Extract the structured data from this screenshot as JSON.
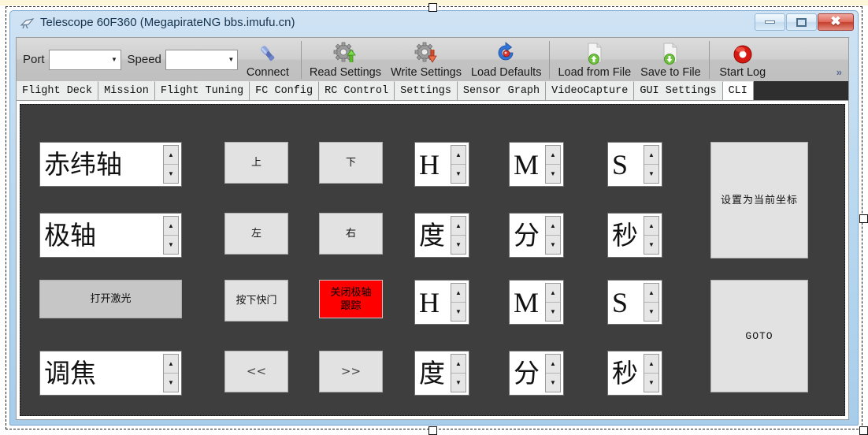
{
  "window": {
    "title": "Telescope 60F360 (MegapirateNG bbs.imufu.cn)",
    "icon": "telescope-icon",
    "controls": {
      "minimize": "minimize-icon",
      "maximize": "maximize-icon",
      "close": "✖"
    }
  },
  "toolbar": {
    "port_label": "Port",
    "port_value": "",
    "speed_label": "Speed",
    "speed_value": "",
    "overflow": "»",
    "buttons": [
      {
        "label": "Connect",
        "icon": "plug-icon"
      },
      {
        "label": "Read Settings",
        "icon": "gear-up-icon"
      },
      {
        "label": "Write Settings",
        "icon": "gear-down-icon"
      },
      {
        "label": "Load Defaults",
        "icon": "refresh-icon"
      },
      {
        "label": "Load from File",
        "icon": "file-up-icon"
      },
      {
        "label": "Save to File",
        "icon": "file-down-icon"
      },
      {
        "label": "Start Log",
        "icon": "record-icon"
      }
    ]
  },
  "tabs": [
    {
      "label": "Flight Deck",
      "active": false
    },
    {
      "label": "Mission",
      "active": false
    },
    {
      "label": "Flight Tuning",
      "active": false
    },
    {
      "label": "FC Config",
      "active": false
    },
    {
      "label": "RC Control",
      "active": false
    },
    {
      "label": "Settings",
      "active": false
    },
    {
      "label": "Sensor Graph",
      "active": false
    },
    {
      "label": "VideoCapture",
      "active": false
    },
    {
      "label": "GUI Settings",
      "active": false
    },
    {
      "label": "CLI",
      "active": true
    }
  ],
  "panel": {
    "spinners": [
      {
        "name": "dec-axis-spinner",
        "value": "赤纬轴",
        "cjk": true
      },
      {
        "name": "ra-axis-spinner",
        "value": "极轴",
        "cjk": true
      },
      {
        "name": "focus-spinner",
        "value": "调焦",
        "cjk": true
      },
      {
        "name": "target-hour-spinner",
        "value": "H",
        "cjk": false
      },
      {
        "name": "target-minute-spinner",
        "value": "M",
        "cjk": false
      },
      {
        "name": "target-second-spinner",
        "value": "S",
        "cjk": false
      },
      {
        "name": "target-degree-spinner",
        "value": "度",
        "cjk": true
      },
      {
        "name": "target-arcmin-spinner",
        "value": "分",
        "cjk": true
      },
      {
        "name": "target-arcsec-spinner",
        "value": "秒",
        "cjk": true
      },
      {
        "name": "goto-hour-spinner",
        "value": "H",
        "cjk": false
      },
      {
        "name": "goto-minute-spinner",
        "value": "M",
        "cjk": false
      },
      {
        "name": "goto-second-spinner",
        "value": "S",
        "cjk": false
      },
      {
        "name": "goto-degree-spinner",
        "value": "度",
        "cjk": true
      },
      {
        "name": "goto-arcmin-spinner",
        "value": "分",
        "cjk": true
      },
      {
        "name": "goto-arcsec-spinner",
        "value": "秒",
        "cjk": true
      }
    ],
    "spin_up": "▲",
    "spin_down": "▼",
    "buttons": {
      "up": "上",
      "down": "下",
      "left": "左",
      "right": "右",
      "laser": "打开激光",
      "shutter": "按下快门",
      "tracking": "关闭极轴\n跟踪",
      "tracking_line1": "关闭极轴",
      "tracking_line2": "跟踪",
      "set_current": "设置为当前坐标",
      "goto": "GOTO",
      "focus_back": "<<",
      "focus_fwd": ">>"
    },
    "colors": {
      "panel_bg": "#3e3e3e",
      "tracking_bg": "#ff0000",
      "laser_bg": "#c6c6c6"
    }
  }
}
